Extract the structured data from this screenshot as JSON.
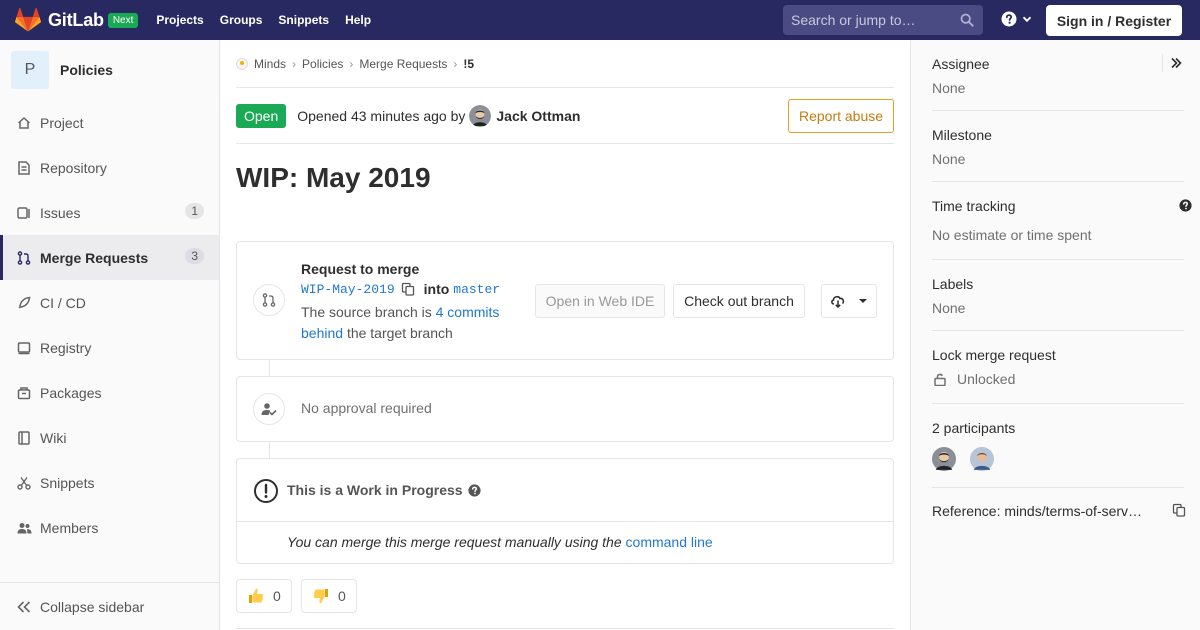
{
  "topbar": {
    "brand": "GitLab",
    "badge": "Next",
    "links": [
      "Projects",
      "Groups",
      "Snippets",
      "Help"
    ],
    "search_placeholder": "Search or jump to…",
    "signin_label": "Sign in / Register"
  },
  "sidebar": {
    "project_initial": "P",
    "project_name": "Policies",
    "items": [
      {
        "label": "Project",
        "icon": "home-icon"
      },
      {
        "label": "Repository",
        "icon": "doc-icon"
      },
      {
        "label": "Issues",
        "icon": "issues-icon",
        "badge": "1"
      },
      {
        "label": "Merge Requests",
        "icon": "merge-request-icon",
        "badge": "3",
        "active": true
      },
      {
        "label": "CI / CD",
        "icon": "rocket-icon"
      },
      {
        "label": "Registry",
        "icon": "container-icon"
      },
      {
        "label": "Packages",
        "icon": "package-icon"
      },
      {
        "label": "Wiki",
        "icon": "book-icon"
      },
      {
        "label": "Snippets",
        "icon": "scissors-icon"
      },
      {
        "label": "Members",
        "icon": "users-icon"
      }
    ],
    "collapse_label": "Collapse sidebar"
  },
  "breadcrumb": [
    "Minds",
    "Policies",
    "Merge Requests",
    "!5"
  ],
  "mr": {
    "status": "Open",
    "opened_text": "Opened 43 minutes ago by",
    "author": "Jack Ottman",
    "report_label": "Report abuse",
    "title": "WIP: May 2019"
  },
  "merge_widget": {
    "heading": "Request to merge",
    "source_branch": "WIP-May-2019",
    "into_label": "into",
    "target_branch": "master",
    "behind_prefix": "The source branch is",
    "behind_link": "4 commits behind",
    "behind_suffix": "the target branch",
    "open_ide_label": "Open in Web IDE",
    "checkout_label": "Check out branch"
  },
  "approval": {
    "text": "No approval required"
  },
  "wip": {
    "heading": "This is a Work in Progress",
    "manual_prefix": "You can merge this merge request manually using the",
    "manual_link": "command line"
  },
  "reactions": {
    "thumbs_up": "0",
    "thumbs_down": "0"
  },
  "right_sidebar": {
    "assignee_title": "Assignee",
    "assignee_value": "None",
    "milestone_title": "Milestone",
    "milestone_value": "None",
    "time_title": "Time tracking",
    "time_value": "No estimate or time spent",
    "labels_title": "Labels",
    "labels_value": "None",
    "lock_title": "Lock merge request",
    "lock_value": "Unlocked",
    "participants_title": "2 participants",
    "reference_text": "Reference: minds/terms-of-serv…"
  }
}
